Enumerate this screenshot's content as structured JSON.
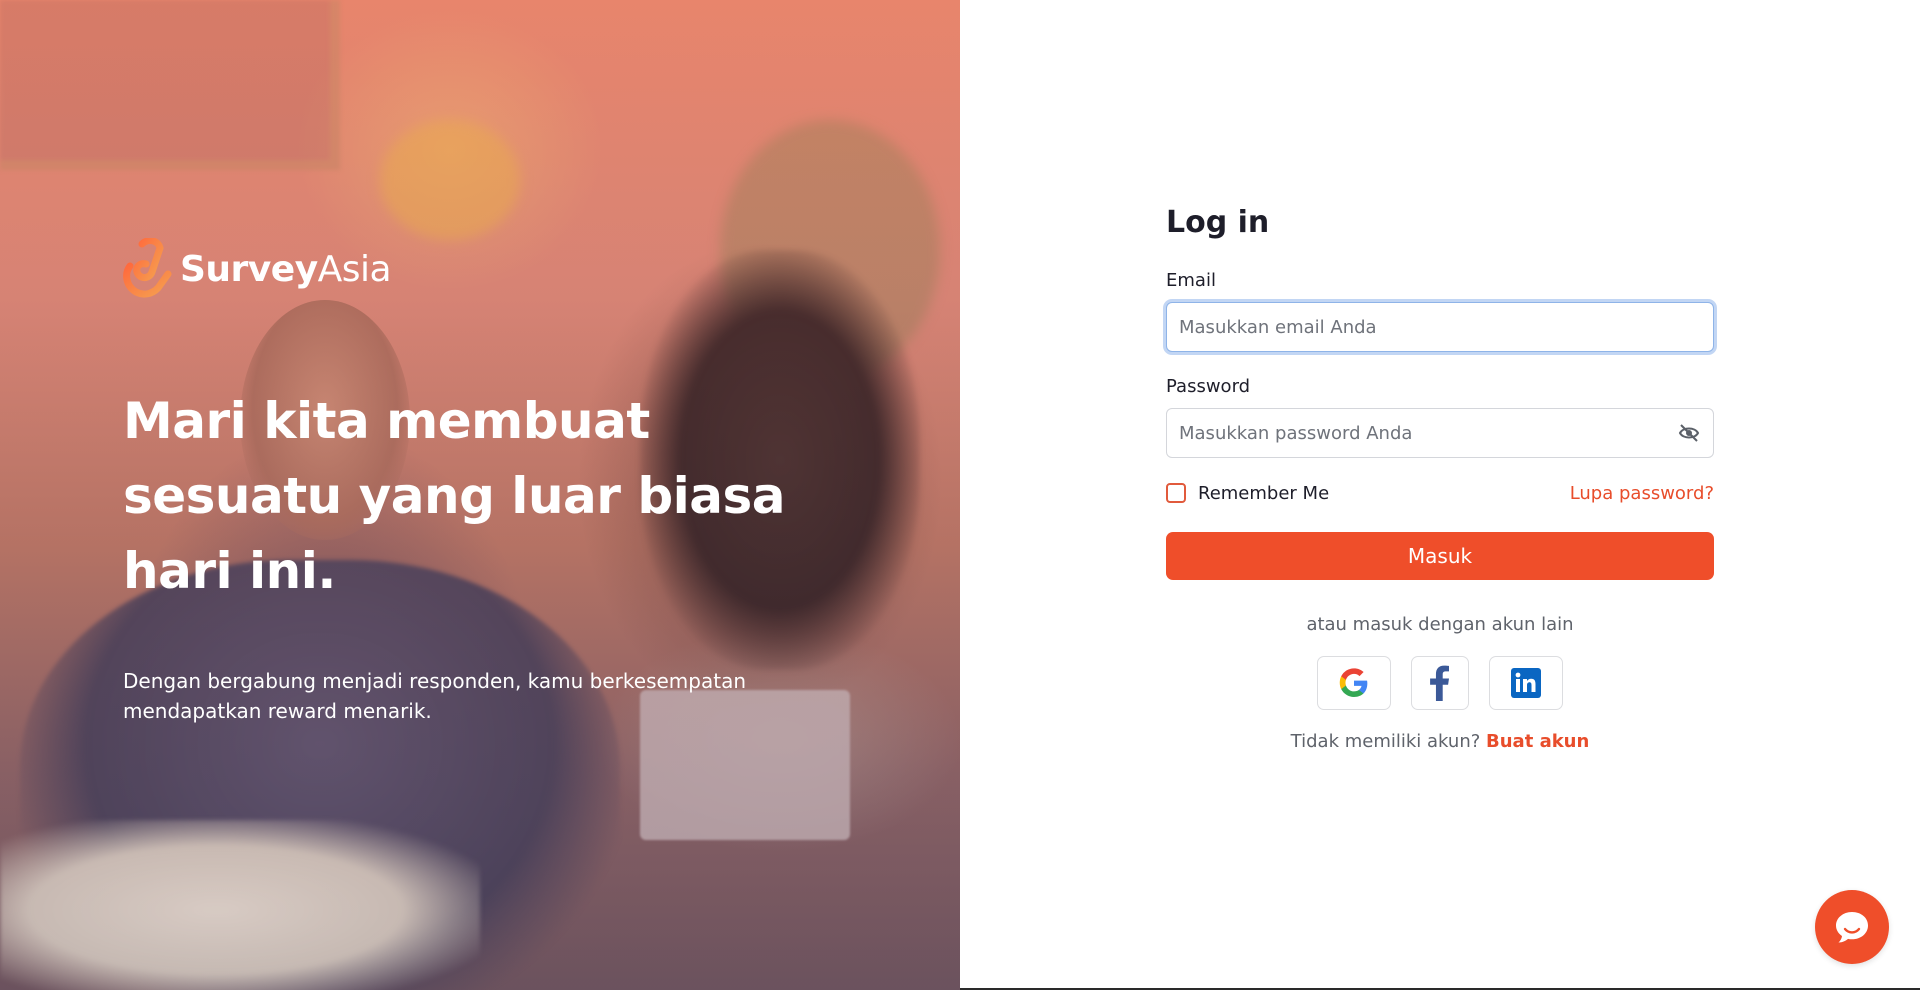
{
  "brand": {
    "name_bold": "Survey",
    "name_regular": "Asia",
    "accent_color": "#ef4e2a"
  },
  "hero": {
    "title": "Mari kita membuat sesuatu yang luar biasa hari ini.",
    "subtitle": "Dengan bergabung menjadi responden, kamu berkesempatan mendapatkan reward menarik."
  },
  "login": {
    "heading": "Log in",
    "email": {
      "label": "Email",
      "placeholder": "Masukkan email Anda",
      "value": ""
    },
    "password": {
      "label": "Password",
      "placeholder": "Masukkan password Anda",
      "value": "",
      "toggle_icon": "eye-off-icon"
    },
    "remember_label": "Remember Me",
    "remember_checked": false,
    "forgot_label": "Lupa password?",
    "submit_label": "Masuk",
    "alt_text": "atau masuk dengan akun lain",
    "social": [
      {
        "name": "google",
        "icon": "google-icon"
      },
      {
        "name": "facebook",
        "icon": "facebook-icon"
      },
      {
        "name": "linkedin",
        "icon": "linkedin-icon"
      }
    ],
    "signup_prompt": "Tidak memiliki akun?",
    "signup_link": "Buat akun"
  },
  "chat": {
    "icon": "chat-bubble-icon"
  }
}
